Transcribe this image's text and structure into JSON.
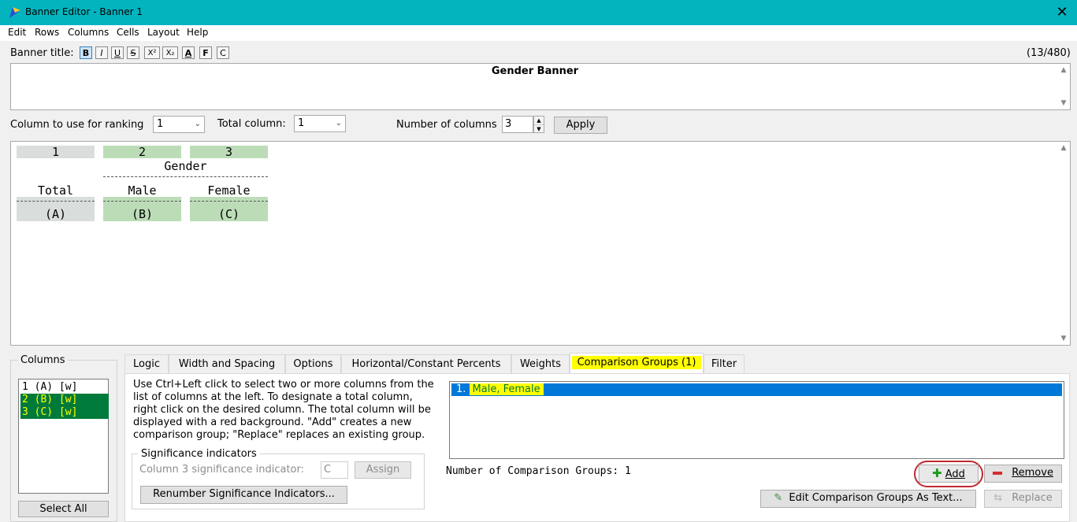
{
  "window": {
    "title": "Banner Editor - Banner 1",
    "close_glyph": "✕",
    "icon": "banner-app-icon"
  },
  "menu": [
    "Edit",
    "Rows",
    "Columns",
    "Cells",
    "Layout",
    "Help"
  ],
  "toolbar": {
    "label": "Banner title:",
    "buttons": [
      "B",
      "I",
      "U",
      "S",
      "X²",
      "X₂",
      "A",
      "F",
      "C"
    ],
    "counter": "(13/480)"
  },
  "banner_title": "Gender Banner",
  "controls": {
    "ranking_label": "Column to use for ranking",
    "ranking_value": "1",
    "total_label": "Total column:",
    "total_value": "1",
    "numcols_label": "Number of columns",
    "numcols_value": "3",
    "apply_label": "Apply"
  },
  "banner": {
    "col_numbers": [
      "1",
      "2",
      "3"
    ],
    "group_label": "Gender",
    "headers": [
      "Total",
      "Male",
      "Female"
    ],
    "letters": [
      "(A)",
      "(B)",
      "(C)"
    ]
  },
  "columns_panel": {
    "title": "Columns",
    "items": [
      "1 (A) [w]",
      "2 (B) [w]",
      "3 (C) [w]"
    ],
    "select_all": "Select All"
  },
  "tabs": [
    "Logic",
    "Width and Spacing",
    "Options",
    "Horizontal/Constant Percents",
    "Weights",
    "Comparison Groups (1)",
    "Filter"
  ],
  "comparison": {
    "description_lines": [
      "Use Ctrl+Left click to select two or more columns from the",
      "list of columns at the left. To designate a total column,",
      "right click on the desired column. The total column will be",
      "displayed with a red background. \"Add\" creates a new",
      "comparison group; \"Replace\" replaces an existing group."
    ],
    "sig_group_title": "Significance indicators",
    "sig_label": "Column 3 significance indicator:",
    "sig_value": "C",
    "assign_label": "Assign",
    "renumber_label": "Renumber Significance Indicators...",
    "group_number": "1.",
    "group_text": "Male, Female",
    "count_text": "Number of Comparison Groups: 1",
    "add_label": "Add",
    "remove_label": "Remove",
    "edit_label": "Edit Comparison Groups As Text...",
    "replace_label": "Replace"
  }
}
